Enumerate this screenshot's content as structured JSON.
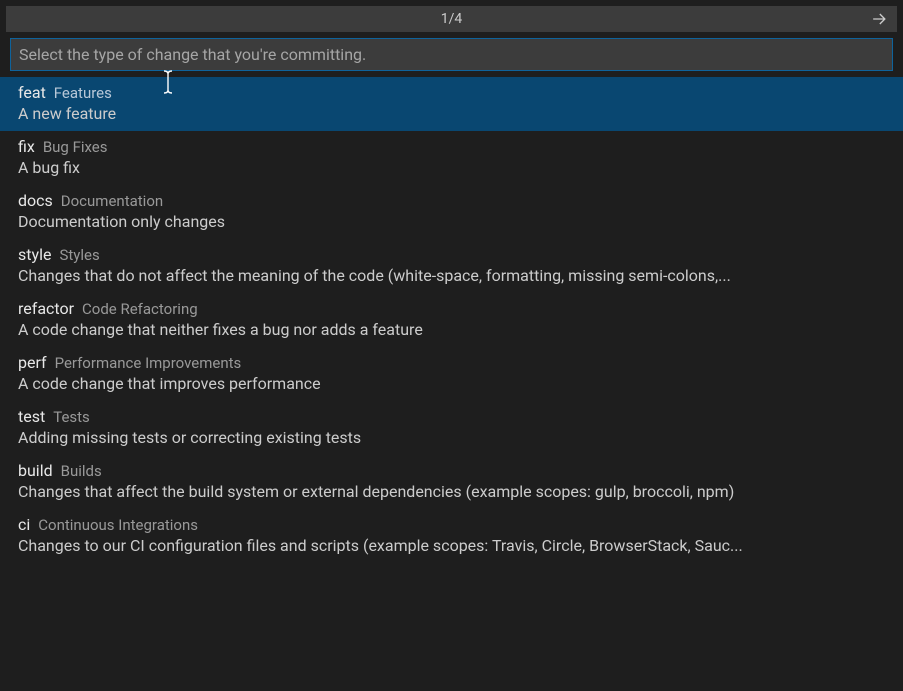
{
  "header": {
    "step_counter": "1/4"
  },
  "input": {
    "placeholder": "Select the type of change that you're committing.",
    "value": ""
  },
  "items": [
    {
      "key": "feat",
      "label": "Features",
      "description": "A new feature",
      "selected": true
    },
    {
      "key": "fix",
      "label": "Bug Fixes",
      "description": "A bug fix",
      "selected": false
    },
    {
      "key": "docs",
      "label": "Documentation",
      "description": "Documentation only changes",
      "selected": false
    },
    {
      "key": "style",
      "label": "Styles",
      "description": "Changes that do not affect the meaning of the code (white-space, formatting, missing semi-colons,...",
      "selected": false
    },
    {
      "key": "refactor",
      "label": "Code Refactoring",
      "description": "A code change that neither fixes a bug nor adds a feature",
      "selected": false
    },
    {
      "key": "perf",
      "label": "Performance Improvements",
      "description": "A code change that improves performance",
      "selected": false
    },
    {
      "key": "test",
      "label": "Tests",
      "description": "Adding missing tests or correcting existing tests",
      "selected": false
    },
    {
      "key": "build",
      "label": "Builds",
      "description": "Changes that affect the build system or external dependencies (example scopes: gulp, broccoli, npm)",
      "selected": false
    },
    {
      "key": "ci",
      "label": "Continuous Integrations",
      "description": "Changes to our CI configuration files and scripts (example scopes: Travis, Circle, BrowserStack, Sauc...",
      "selected": false
    }
  ]
}
